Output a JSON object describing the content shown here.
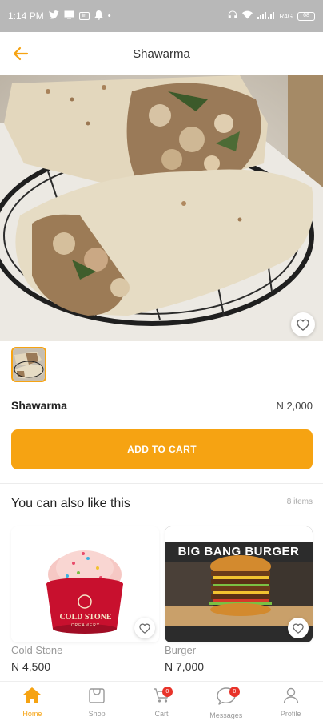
{
  "status_bar": {
    "time": "1:14 PM",
    "battery": "68"
  },
  "header": {
    "title": "Shawarma"
  },
  "product": {
    "name": "Shawarma",
    "price": "N 2,000"
  },
  "actions": {
    "add_to_cart": "ADD TO CART"
  },
  "recommendations": {
    "title": "You can also like this",
    "count": "8 items",
    "items": [
      {
        "name": "Cold Stone",
        "price": "N 4,500",
        "image_text": "COLD STONE",
        "image_subtext": "CREAMERY"
      },
      {
        "name": "Burger",
        "price": "N 7,000",
        "image_text": "BIG BANG BURGER"
      }
    ]
  },
  "bottom_nav": {
    "items": [
      {
        "label": "Home",
        "icon": "home-icon",
        "active": true
      },
      {
        "label": "Shop",
        "icon": "shop-icon"
      },
      {
        "label": "Cart",
        "icon": "cart-icon",
        "badge": "0"
      },
      {
        "label": "Messages",
        "icon": "messages-icon",
        "badge": "0"
      },
      {
        "label": "Profile",
        "icon": "profile-icon"
      }
    ]
  },
  "colors": {
    "accent": "#f6a312",
    "badge": "#e8332a",
    "statusbar": "#b8b8b8"
  }
}
